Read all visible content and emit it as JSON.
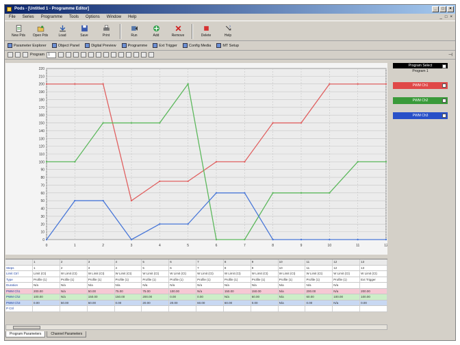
{
  "app": {
    "title": "Pods - [Untitled 1 - Programme Editor]",
    "window_buttons": [
      "_",
      "□",
      "×"
    ]
  },
  "menu": [
    "File",
    "Series",
    "Programme",
    "Tools",
    "Options",
    "Window",
    "Help"
  ],
  "menu_right": [
    "_",
    "□",
    "×"
  ],
  "toolbar1": [
    {
      "label": "New Pds",
      "icon": "new-pds-icon"
    },
    {
      "label": "Open Pds",
      "icon": "open-pds-icon"
    },
    {
      "label": "Load",
      "icon": "load-icon"
    },
    {
      "label": "Save",
      "icon": "save-icon"
    },
    {
      "label": "Print",
      "icon": "print-icon"
    },
    {
      "label": "Run",
      "icon": "run-icon"
    },
    {
      "label": "Add",
      "icon": "add-icon"
    },
    {
      "label": "Remove",
      "icon": "remove-icon"
    },
    {
      "label": "Delete",
      "icon": "delete-icon"
    },
    {
      "label": "Help",
      "icon": "help-icon"
    }
  ],
  "toolbar2": [
    "Parameter Explorer",
    "Object Panel",
    "Digital Preview",
    "Programme",
    "Ext Trigger",
    "Config Media",
    "MT Setup"
  ],
  "toolbar3": {
    "program_label": "Program",
    "program_value": "1"
  },
  "colors": {
    "red": "#e04848",
    "green": "#3a9a3a",
    "blue": "#2850c8"
  },
  "legend": {
    "header": "Program Select",
    "subtitle": "Program 1",
    "items": [
      "PWM Ch1",
      "PWM Ch2",
      "PWM Ch3"
    ]
  },
  "chart_data": {
    "type": "line",
    "x": [
      0,
      1,
      2,
      3,
      4,
      5,
      6,
      7,
      8,
      9,
      10,
      11,
      12
    ],
    "xlim": [
      0,
      12
    ],
    "ylim": [
      0,
      220
    ],
    "yticks": [
      0,
      10,
      20,
      30,
      40,
      50,
      60,
      70,
      80,
      90,
      100,
      110,
      120,
      130,
      140,
      150,
      160,
      170,
      180,
      190,
      200,
      210,
      220
    ],
    "grid": true,
    "series": [
      {
        "name": "PWM Ch1",
        "color": "#e06060",
        "values": [
          200,
          200,
          200,
          50,
          75,
          75,
          100,
          100,
          150,
          150,
          200,
          200,
          200
        ]
      },
      {
        "name": "PWM Ch2",
        "color": "#5cb85c",
        "values": [
          100,
          100,
          150,
          150,
          150,
          200,
          0,
          0,
          60,
          60,
          60,
          100,
          100
        ]
      },
      {
        "name": "PWM Ch3",
        "color": "#4a78d8",
        "values": [
          0,
          50,
          50,
          0,
          20,
          20,
          60,
          60,
          0,
          0,
          0,
          0,
          0
        ]
      }
    ]
  },
  "grid_table": {
    "columns": [
      "1",
      "2",
      "3",
      "4",
      "5",
      "6",
      "7",
      "8",
      "9",
      "10",
      "11",
      "12",
      "13"
    ],
    "rows": [
      {
        "label": "Steps",
        "cells": [
          "1",
          "2",
          "3",
          "4",
          "5",
          "6",
          "7",
          "8",
          "9",
          "10",
          "11",
          "12",
          "13"
        ]
      },
      {
        "label": "Limit Ctrl",
        "cells": [
          "Limit (Ct)",
          "W Limit (Ct)",
          "W Limit (Ct)",
          "W Limit (Ct)",
          "W Limit (Ct)",
          "W Limit (Ct)",
          "W Limit (Ct)",
          "W Limit (Ct)",
          "W Limit (Ct)",
          "W Limit (Ct)",
          "W Limit (Ct)",
          "W Limit (Ct)",
          "W Limit (Ct)"
        ]
      },
      {
        "label": "Type",
        "cells": [
          "Profile (1)",
          "Profile (1)",
          "Profile (1)",
          "Profile (1)",
          "Profile (1)",
          "Profile (1)",
          "Profile (1)",
          "Profile (1)",
          "Profile (1)",
          "Profile (1)",
          "Profile (1)",
          "Profile (1)",
          "Ext Trigger"
        ]
      },
      {
        "label": "Duration",
        "cells": [
          "N/a",
          "N/a",
          "N/a",
          "N/a",
          "N/a",
          "N/a",
          "N/a",
          "N/a",
          "N/a",
          "N/a",
          "N/a",
          "N/a",
          ""
        ]
      },
      {
        "label": "PWM Ch1",
        "cells": [
          "200.00",
          "N/a",
          "50.00",
          "75.00",
          "75.00",
          "100.00",
          "N/a",
          "150.00",
          "150.00",
          "N/a",
          "200.00",
          "N/a",
          "200.00"
        ]
      },
      {
        "label": "PWM Ch2",
        "cells": [
          "100.00",
          "N/a",
          "150.00",
          "150.00",
          "200.00",
          "0.00",
          "0.00",
          "N/a",
          "60.00",
          "N/a",
          "60.00",
          "100.00",
          "100.00"
        ]
      },
      {
        "label": "PWM Ch3",
        "cells": [
          "0.00",
          "50.00",
          "50.00",
          "0.00",
          "20.00",
          "20.00",
          "60.00",
          "60.00",
          "0.00",
          "N/a",
          "0.00",
          "N/a",
          "0.00"
        ]
      },
      {
        "label": "P Ctrl",
        "cells": [
          "",
          "",
          "",
          "",
          "",
          "",
          "",
          "",
          "",
          "",
          "",
          "",
          ""
        ]
      }
    ]
  },
  "tabs": [
    "Program Parameters",
    "Channel Parameters"
  ]
}
